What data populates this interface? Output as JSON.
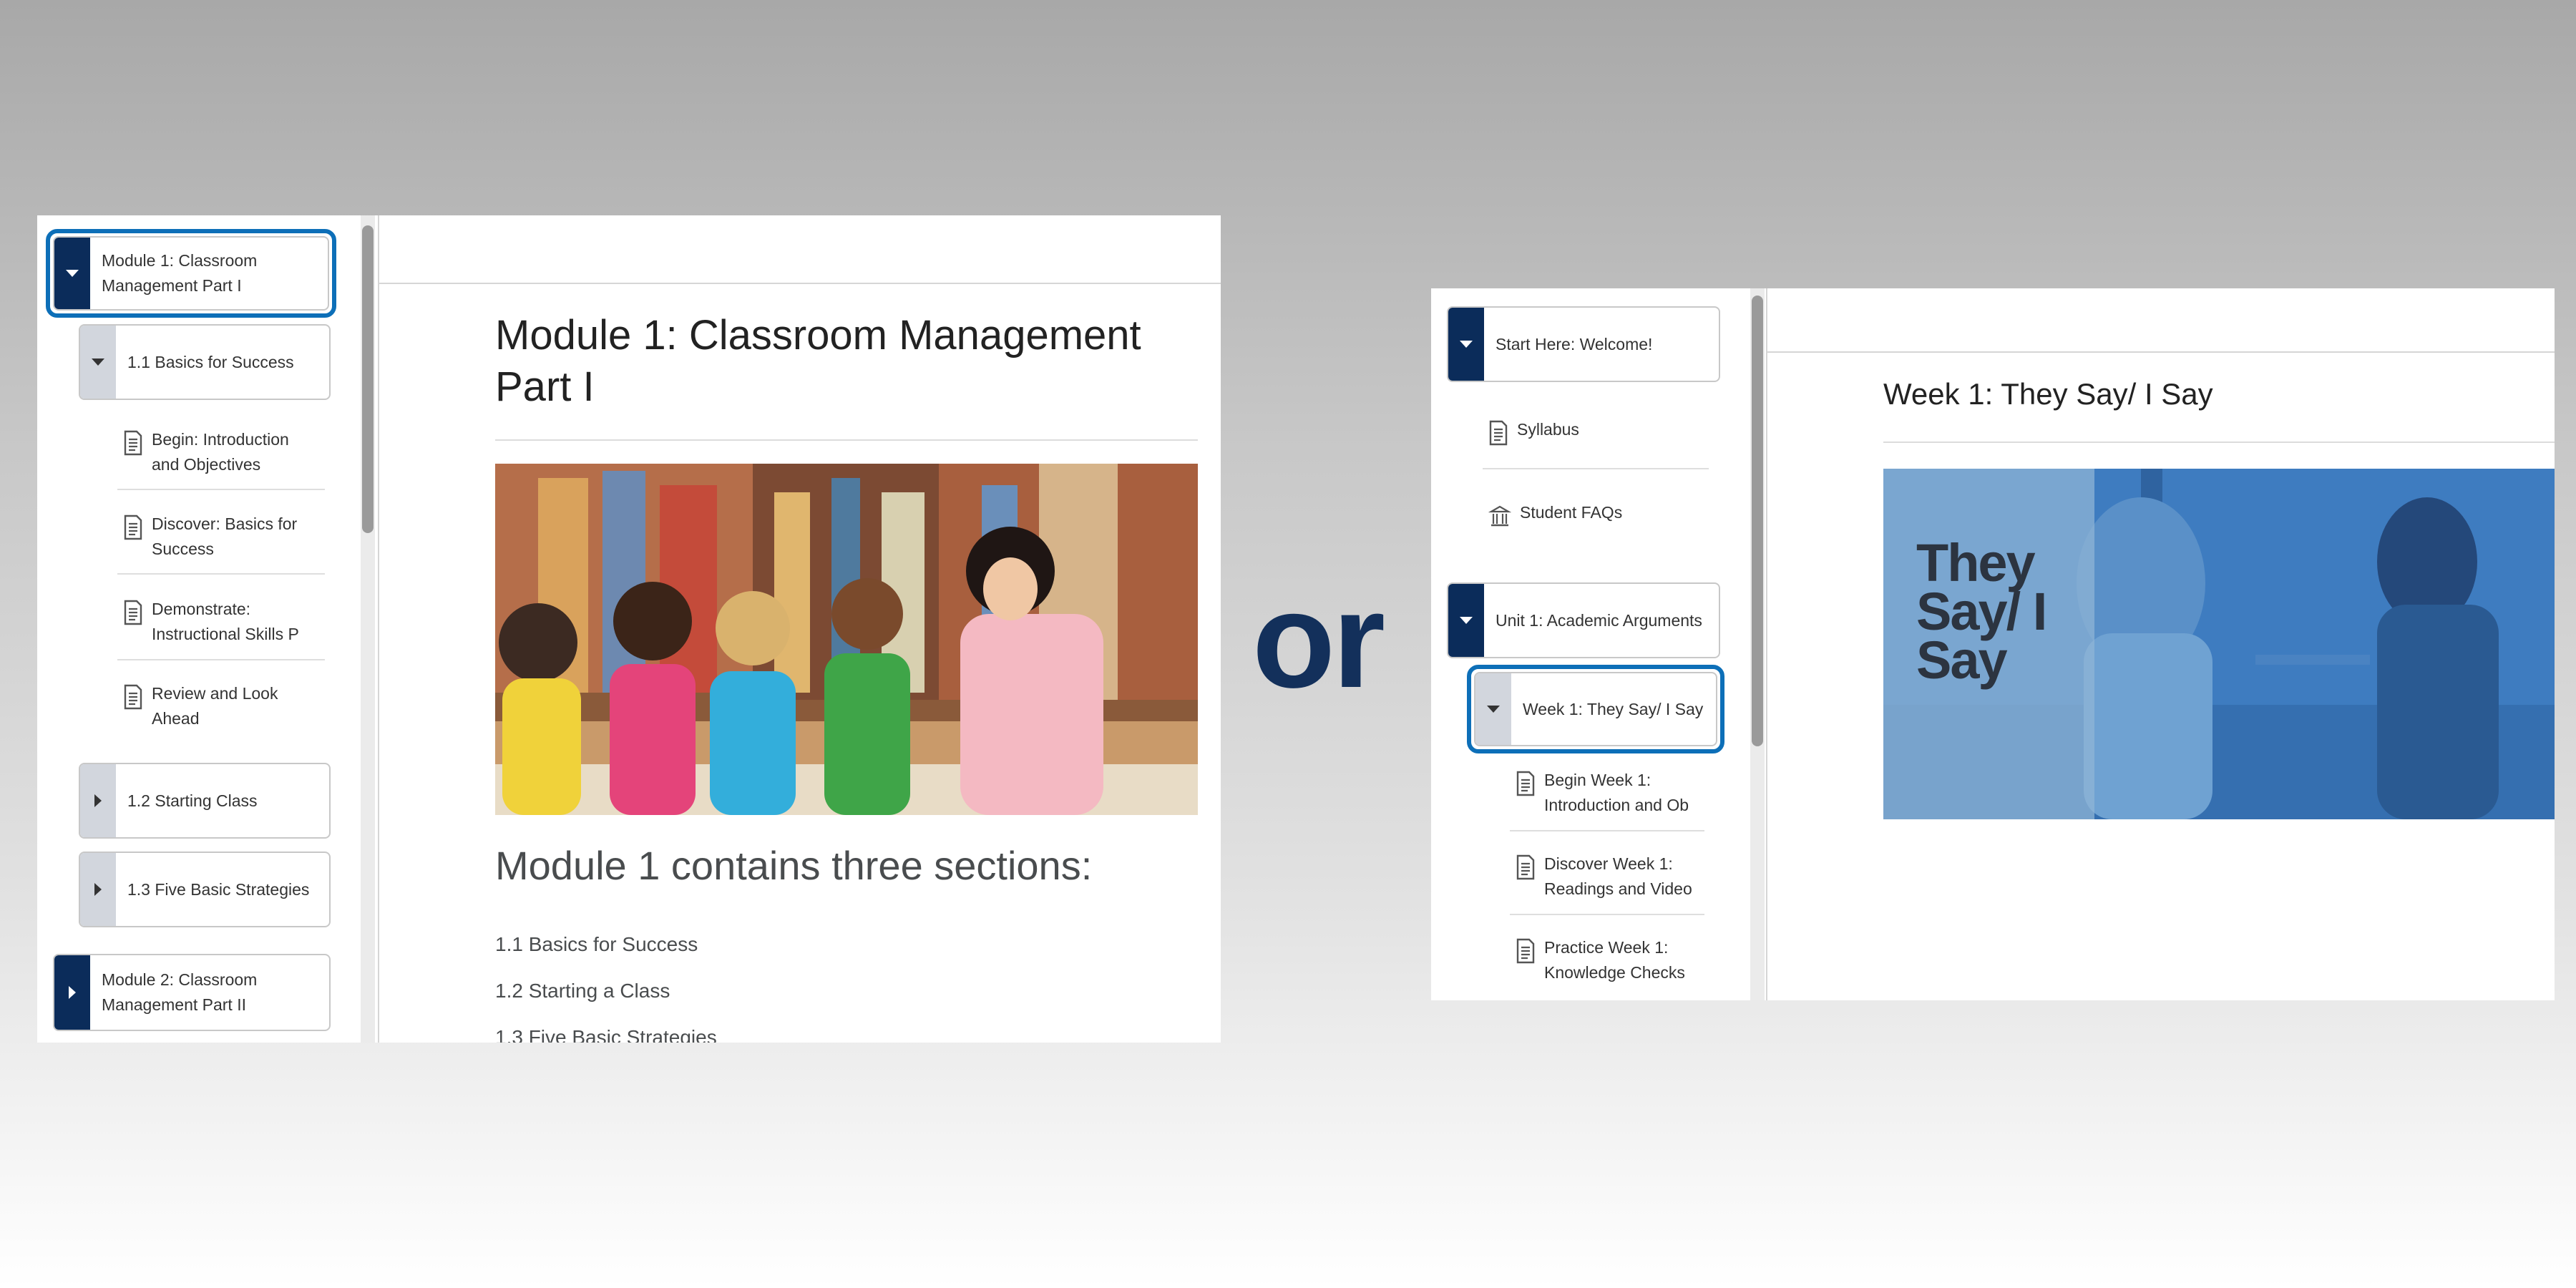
{
  "left": {
    "nav": {
      "module1": "Module 1: Classroom Management Part I",
      "section_1_1": "1.1 Basics for Success",
      "topics": [
        "Begin: Introduction and Objectives",
        "Discover: Basics for Success",
        "Demonstrate: Instructional Skills P",
        "Review and Look Ahead"
      ],
      "section_1_2": "1.2 Starting Class",
      "section_1_3": "1.3 Five Basic Strategies",
      "module2": "Module 2: Classroom Management Part II"
    },
    "content": {
      "title": "Module 1: Classroom Management Part I",
      "heading": "Module 1 contains three sections:",
      "list": [
        "1.1 Basics for Success",
        "1.2 Starting a Class",
        "1.3 Five Basic Strategies"
      ]
    }
  },
  "or_text": "or",
  "right": {
    "nav": {
      "start_here": "Start Here: Welcome!",
      "syllabus": "Syllabus",
      "faqs": "Student FAQs",
      "unit1": "Unit 1: Academic Arguments",
      "week1": "Week 1: They Say/ I Say",
      "topics": [
        "Begin Week 1: Introduction and Ob",
        "Discover Week 1: Readings and Video",
        "Practice Week 1: Knowledge Checks"
      ]
    },
    "content": {
      "title": "Week 1: They Say/ I Say",
      "banner": "They Say/ I Say"
    }
  },
  "colors": {
    "navy_strip": "#0b2c5a",
    "light_strip": "#d2d6dd",
    "focus_ring": "#0d6fb8",
    "or_text": "#13305b"
  },
  "icons": [
    "page-icon",
    "institution-icon",
    "caret-down-icon",
    "caret-right-icon"
  ]
}
